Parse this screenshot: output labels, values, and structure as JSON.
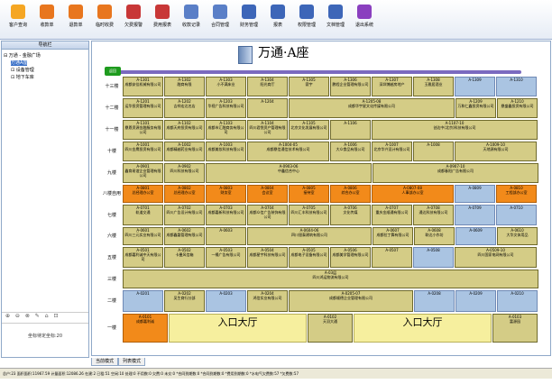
{
  "toolbar": [
    {
      "label": "客户查询",
      "icon": "customer-search-icon",
      "color": "#f5a623"
    },
    {
      "label": "收款单",
      "icon": "receipt-icon",
      "color": "#e8761e"
    },
    {
      "label": "退款单",
      "icon": "refund-icon",
      "color": "#e8761e"
    },
    {
      "label": "临时收费",
      "icon": "temp-charge-icon",
      "color": "#e8761e"
    },
    {
      "label": "欠费报警",
      "icon": "alarm-icon",
      "color": "#c83737"
    },
    {
      "label": "费用报表",
      "icon": "fee-report-icon",
      "color": "#c83737"
    },
    {
      "label": "收款记录",
      "icon": "receipt-record-icon",
      "color": "#5a7fc7"
    },
    {
      "label": "合同管理",
      "icon": "contract-icon",
      "color": "#5a7fc7"
    },
    {
      "label": "财务管理",
      "icon": "finance-icon",
      "color": "#3d66b8"
    },
    {
      "label": "报表",
      "icon": "report-icon",
      "color": "#3d66b8"
    },
    {
      "label": "权限管理",
      "icon": "permission-icon",
      "color": "#3d66b8"
    },
    {
      "label": "文档管理",
      "icon": "document-icon",
      "color": "#3d66b8"
    },
    {
      "label": "退出系统",
      "icon": "power-icon",
      "color": "#8a3fbf"
    }
  ],
  "sidebar": {
    "header": "导航栏",
    "tree": [
      "万通 - 金融广场",
      "万通A座",
      "设备管理",
      "地下车库"
    ],
    "controls": "⊕ ⊖ ⊗ ✎ ⌂ ⊡",
    "coord_label": "坐标待定坐标:20"
  },
  "canvas": {
    "title": "万通·A座",
    "back_label": "返回"
  },
  "colors": {
    "tan": "#d4cc86",
    "blue": "#aac4e2",
    "orange": "#f28a1a",
    "lemon": "#f6ef9e"
  },
  "floors": [
    {
      "label": "十三楼",
      "tiles": [
        {
          "id": "A-1301",
          "name": "成都安佳机械有限公司",
          "c": "tan"
        },
        {
          "id": "A-1302",
          "name": "融商有限",
          "c": "tan"
        },
        {
          "id": "A-1303",
          "name": "小不满床业",
          "c": "tan"
        },
        {
          "id": "A-1304",
          "name": "阳光商厅",
          "c": "tan"
        },
        {
          "id": "A-1305",
          "name": "寰宇",
          "c": "tan"
        },
        {
          "id": "A-1306",
          "name": "鹏程企业管理有限公司",
          "c": "tan"
        },
        {
          "id": "A-1307",
          "name": "深圳博越房地产",
          "c": "tan"
        },
        {
          "id": "A-1308",
          "name": "玉雅居酒业",
          "c": "tan"
        },
        {
          "id": "A-1309",
          "name": "",
          "c": "blue"
        },
        {
          "id": "A-1310",
          "name": "",
          "c": "blue"
        }
      ]
    },
    {
      "label": "十二楼",
      "tiles": [
        {
          "id": "A-1201",
          "name": "运华投资管理有限公司",
          "c": "tan"
        },
        {
          "id": "A-1202",
          "name": "吉祥宏达名店",
          "c": "tan"
        },
        {
          "id": "A-1203",
          "name": "华视广告科技有限公司",
          "c": "tan"
        },
        {
          "id": "A-1204",
          "name": "",
          "c": "tan"
        },
        {
          "id": "A-1205-08",
          "name": "成都华宇星文化传媒有限公司",
          "c": "tan"
        },
        {
          "id": "A-1209",
          "name": "万和仁鑫投资有限公司",
          "c": "tan"
        },
        {
          "id": "A-1210",
          "name": "鼎盛鑫投资有限公司",
          "c": "tan"
        }
      ]
    },
    {
      "label": "十一楼",
      "tiles": [
        {
          "id": "A-1101",
          "name": "鼎恩资源金融服务有限公司",
          "c": "tan"
        },
        {
          "id": "A-1102",
          "name": "成都天府投资有限公司",
          "c": "tan"
        },
        {
          "id": "A-1103",
          "name": "成都市汇融商务有限公司",
          "c": "tan"
        },
        {
          "id": "A-1104",
          "name": "四川君悦资产管理有限公司",
          "c": "tan"
        },
        {
          "id": "A-1105",
          "name": "北京文化发展有限公司",
          "c": "tan"
        },
        {
          "id": "A-1106",
          "name": "",
          "c": "tan"
        },
        {
          "id": "A-1107-10",
          "name": "创达中(北京)科技有限公司",
          "c": "tan"
        }
      ]
    },
    {
      "label": "十楼",
      "tiles": [
        {
          "id": "A-1001",
          "name": "四川金鹰投资有限公司",
          "c": "tan"
        },
        {
          "id": "A-1002",
          "name": "成都精越药业有限公司",
          "c": "tan"
        },
        {
          "id": "A-1003",
          "name": "成都美妆科技有限公司",
          "c": "tan"
        },
        {
          "id": "A-1004-05",
          "name": "成都鼎信通信技术有限公司",
          "c": "tan"
        },
        {
          "id": "A-1006",
          "name": "大众食品有限公司",
          "c": "tan"
        },
        {
          "id": "A-1007",
          "name": "北京华兴设计有限公司",
          "c": "tan"
        },
        {
          "id": "A-1008",
          "name": "",
          "c": "tan"
        },
        {
          "id": "A-1009-10",
          "name": "天地源有限公司",
          "c": "tan"
        }
      ]
    },
    {
      "label": "九楼",
      "tiles": [
        {
          "id": "A-0901",
          "name": "鑫育易谊企业管理有限公司",
          "c": "tan"
        },
        {
          "id": "A-0902",
          "name": "四川科技有限公司",
          "c": "tan"
        },
        {
          "id": "A-0903-06",
          "name": "中鑫信合中心",
          "c": "tan"
        },
        {
          "id": "A-0907-10",
          "name": "成都春阳广告有限公司",
          "c": "tan"
        }
      ]
    },
    {
      "label": "八楼自用",
      "tiles": [
        {
          "id": "A-0801",
          "name": "总经理办公室",
          "c": "orange"
        },
        {
          "id": "A-0802",
          "name": "总经理办公室",
          "c": "orange"
        },
        {
          "id": "A-0803",
          "name": "财务室",
          "c": "orange"
        },
        {
          "id": "A-0804",
          "name": "会议室",
          "c": "orange"
        },
        {
          "id": "A-0805",
          "name": "接待室",
          "c": "orange"
        },
        {
          "id": "A-0806",
          "name": "综合办公室",
          "c": "orange"
        },
        {
          "id": "A-0807-08",
          "name": "人事部办公室",
          "c": "orange"
        },
        {
          "id": "A-0809",
          "name": "",
          "c": "blue"
        },
        {
          "id": "A-0810",
          "name": "工程部办公室",
          "c": "orange"
        }
      ]
    },
    {
      "label": "七楼",
      "tiles": [
        {
          "id": "A-0701",
          "name": "轨道交通",
          "c": "tan"
        },
        {
          "id": "A-0702",
          "name": "四川广告设计有限公司",
          "c": "tan"
        },
        {
          "id": "A-0703",
          "name": "成都嘉新科技有限公司",
          "c": "tan"
        },
        {
          "id": "A-0704",
          "name": "成都众信广告装饰有限公司",
          "c": "tan"
        },
        {
          "id": "A-0705",
          "name": "四川汇丰科技有限公司",
          "c": "tan"
        },
        {
          "id": "A-0706",
          "name": "文化传媒",
          "c": "tan"
        },
        {
          "id": "A-0707",
          "name": "重庆金顺通有限公司",
          "c": "tan"
        },
        {
          "id": "A-0708",
          "name": "通达科技有限公司",
          "c": "tan"
        },
        {
          "id": "A-0709",
          "name": "",
          "c": "blue"
        },
        {
          "id": "A-0710",
          "name": "",
          "c": "blue"
        }
      ]
    },
    {
      "label": "六楼",
      "tiles": [
        {
          "id": "A-0601",
          "name": "四川三元实业有限公司",
          "c": "tan"
        },
        {
          "id": "A-0602",
          "name": "成都鑫磐管理有限公司",
          "c": "tan"
        },
        {
          "id": "A-0603",
          "name": "",
          "c": "tan"
        },
        {
          "id": "A-0604-06",
          "name": "四川银泰建筑有限公司",
          "c": "tan"
        },
        {
          "id": "A-0607",
          "name": "成都拉丁舞有限公司",
          "c": "tan"
        },
        {
          "id": "A-0608",
          "name": "联达小作坊",
          "c": "tan"
        },
        {
          "id": "A-0609",
          "name": "",
          "c": "blue"
        },
        {
          "id": "A-0610",
          "name": "大华文体用品",
          "c": "tan"
        }
      ]
    },
    {
      "label": "五楼",
      "tiles": [
        {
          "id": "A-0501",
          "name": "成都嘉利诚中天有限公司",
          "c": "tan"
        },
        {
          "id": "A-0502",
          "name": "卡曼风信箱",
          "c": "tan"
        },
        {
          "id": "A-0503",
          "name": "一桶广告有限公司",
          "c": "tan"
        },
        {
          "id": "A-0504",
          "name": "成都星宇科技有限公司",
          "c": "tan"
        },
        {
          "id": "A-0505",
          "name": "成都电子设备有限公司",
          "c": "tan"
        },
        {
          "id": "A-0506",
          "name": "成都美学管理有限公司",
          "c": "tan"
        },
        {
          "id": "A-0507",
          "name": "",
          "c": "tan"
        },
        {
          "id": "A-0508",
          "name": "",
          "c": "blue"
        },
        {
          "id": "A-0509-10",
          "name": "四川国家电网有限公司",
          "c": "tan"
        }
      ]
    },
    {
      "label": "三楼",
      "tiles": [
        {
          "id": "A-03层",
          "name": "四川鸿运物流有限公司",
          "c": "tan"
        }
      ]
    },
    {
      "label": "二楼",
      "tiles": [
        {
          "id": "A-0201",
          "name": "",
          "c": "blue"
        },
        {
          "id": "A-0202",
          "name": "吴生商行分部",
          "c": "tan"
        },
        {
          "id": "A-0203",
          "name": "",
          "c": "blue"
        },
        {
          "id": "A-0204",
          "name": "鸿信实业有限公司",
          "c": "tan"
        },
        {
          "id": "A-0205-07",
          "name": "成都顺德企业管理有限公司",
          "c": "tan"
        },
        {
          "id": "A-0208",
          "name": "",
          "c": "blue"
        },
        {
          "id": "A-0209",
          "name": "",
          "c": "blue"
        },
        {
          "id": "A-0210",
          "name": "",
          "c": "blue"
        }
      ]
    },
    {
      "label": "一楼",
      "tiles": [
        {
          "id": "A-0101",
          "name": "成都嘉利诚",
          "c": "orange"
        },
        {
          "id": "",
          "name": "入口大厅",
          "c": "lemon",
          "ent": true
        },
        {
          "id": "A-0102",
          "name": "天羽大通",
          "c": "tan"
        },
        {
          "id": "",
          "name": "入口大厅",
          "c": "lemon",
          "ent": true
        },
        {
          "id": "A-0103",
          "name": "富源园",
          "c": "tan"
        }
      ]
    }
  ],
  "tabs": [
    "当前模式",
    "列表模式"
  ],
  "status": "总户:23   面积面积:11967.59   计量面积:12086.26   在建:2   已租:51   空闲:10   处理:0   不用数:0   欠费:0   未交:0   *合同到期数:0   *合同到期数:0   *费用到期数:0   *水电气欠费数:57   *欠费数:57"
}
